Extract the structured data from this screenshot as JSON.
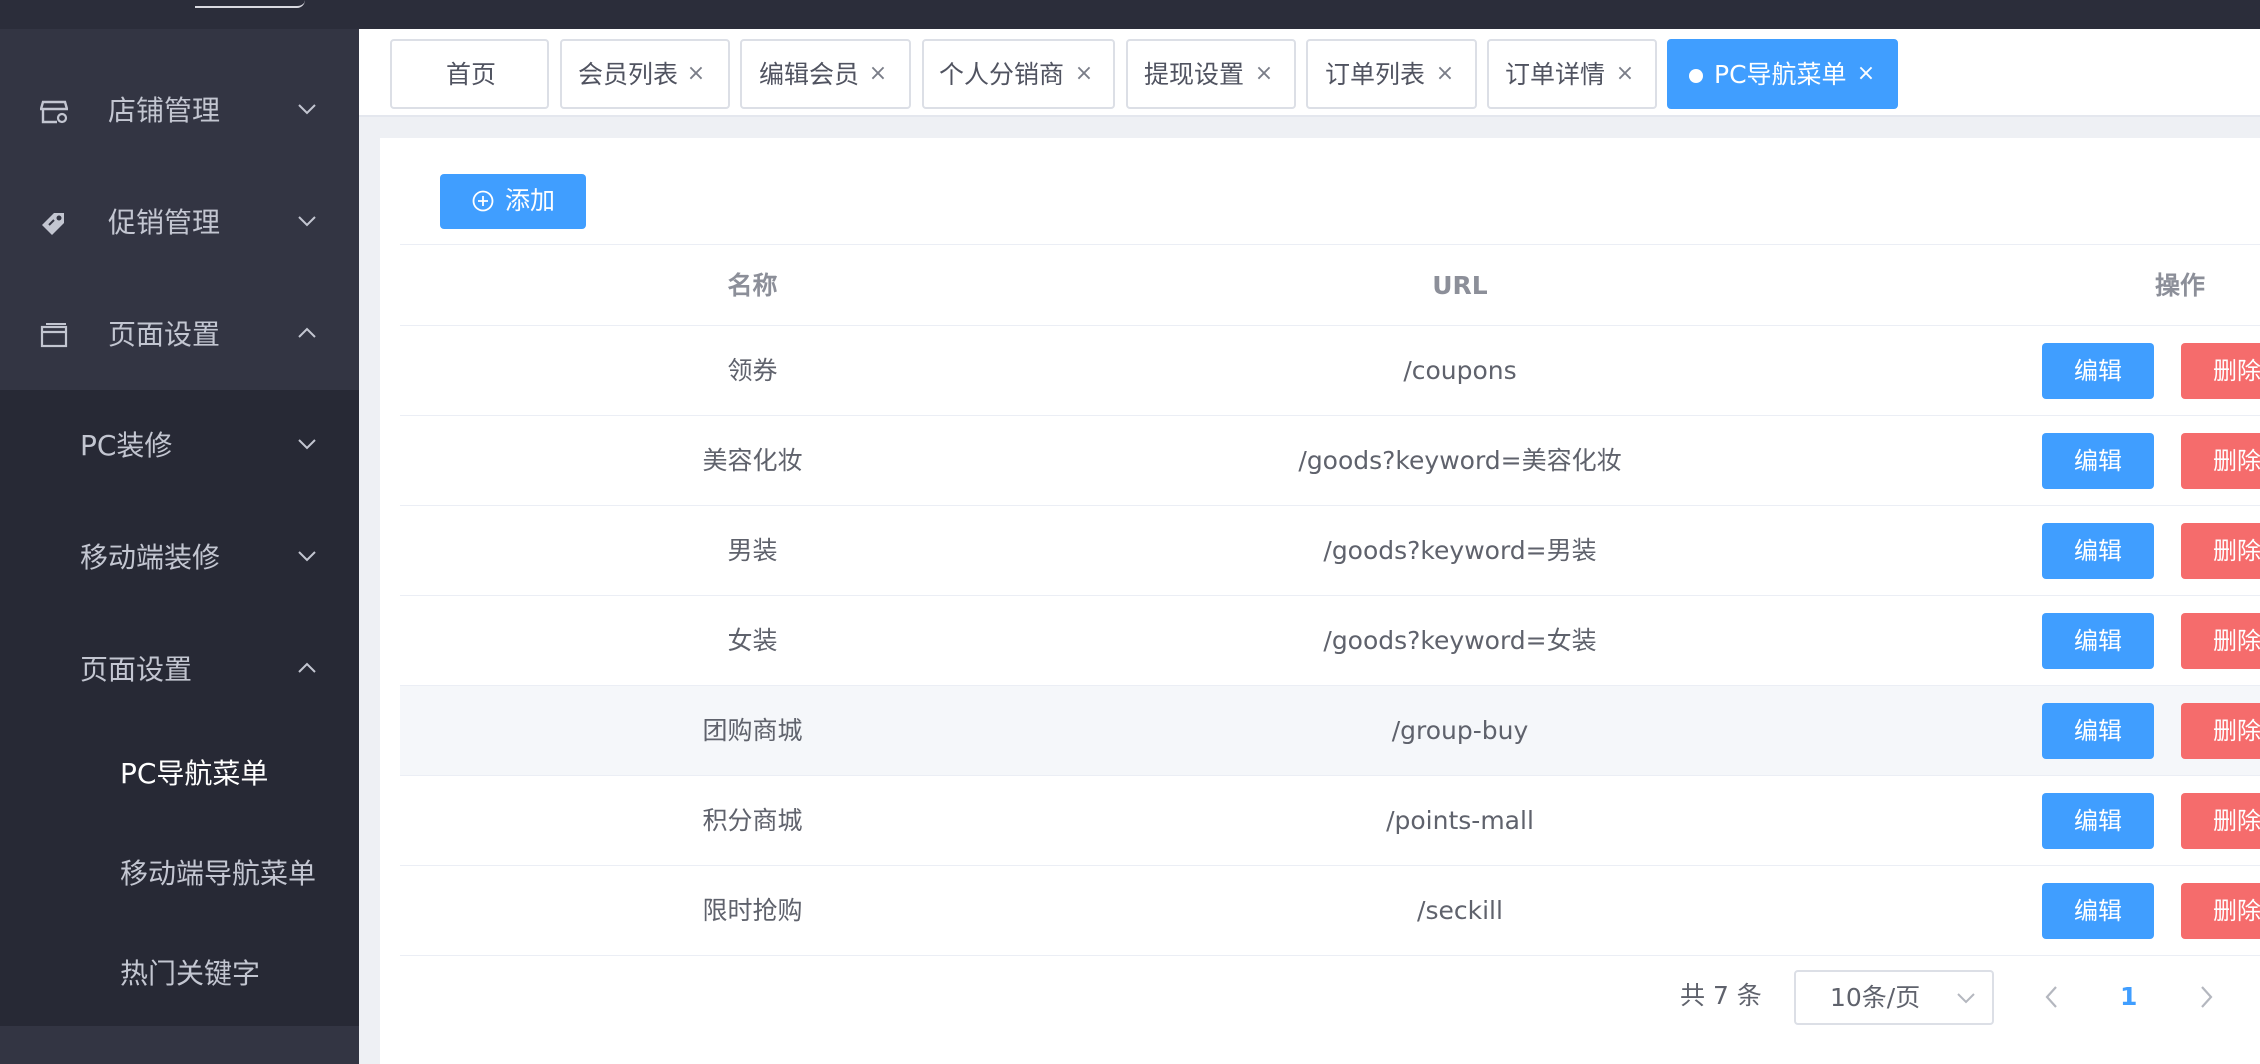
{
  "sidebar": {
    "menus": [
      {
        "label": "店铺管理",
        "icon": "store-icon",
        "expanded": false
      },
      {
        "label": "促销管理",
        "icon": "tag-icon",
        "expanded": false
      },
      {
        "label": "页面设置",
        "icon": "window-icon",
        "expanded": true
      }
    ],
    "submenus": [
      {
        "label": "PC装修",
        "expanded": false
      },
      {
        "label": "移动端装修",
        "expanded": false
      },
      {
        "label": "页面设置",
        "expanded": true
      }
    ],
    "leaves": [
      {
        "label": "PC导航菜单",
        "active": true
      },
      {
        "label": "移动端导航菜单",
        "active": false
      },
      {
        "label": "热门关键字",
        "active": false
      }
    ]
  },
  "tabs": [
    {
      "label": "首页",
      "closable": false,
      "active": false
    },
    {
      "label": "会员列表",
      "closable": true,
      "active": false
    },
    {
      "label": "编辑会员",
      "closable": true,
      "active": false
    },
    {
      "label": "个人分销商",
      "closable": true,
      "active": false
    },
    {
      "label": "提现设置",
      "closable": true,
      "active": false
    },
    {
      "label": "订单列表",
      "closable": true,
      "active": false
    },
    {
      "label": "订单详情",
      "closable": true,
      "active": false
    },
    {
      "label": "PC导航菜单",
      "closable": true,
      "active": true
    }
  ],
  "close_glyph": "×",
  "toolbar": {
    "add_label": "添加"
  },
  "table": {
    "headers": {
      "name": "名称",
      "url": "URL",
      "ops": "操作"
    },
    "rows": [
      {
        "name": "领券",
        "url": "/coupons"
      },
      {
        "name": "美容化妆",
        "url": "/goods?keyword=美容化妆"
      },
      {
        "name": "男装",
        "url": "/goods?keyword=男装"
      },
      {
        "name": "女装",
        "url": "/goods?keyword=女装"
      },
      {
        "name": "团购商城",
        "url": "/group-buy"
      },
      {
        "name": "积分商城",
        "url": "/points-mall"
      },
      {
        "name": "限时抢购",
        "url": "/seckill"
      }
    ],
    "edit_label": "编辑",
    "delete_label": "删除",
    "hover_row": "团购商城"
  },
  "pagination": {
    "total_text": "共 7 条",
    "page_size": "10条/页",
    "current_page": "1"
  },
  "colors": {
    "primary": "#409eff",
    "danger": "#f56c6c",
    "sidebar": "#333543",
    "submenu": "#272935",
    "topbar": "#2b2d3a"
  }
}
